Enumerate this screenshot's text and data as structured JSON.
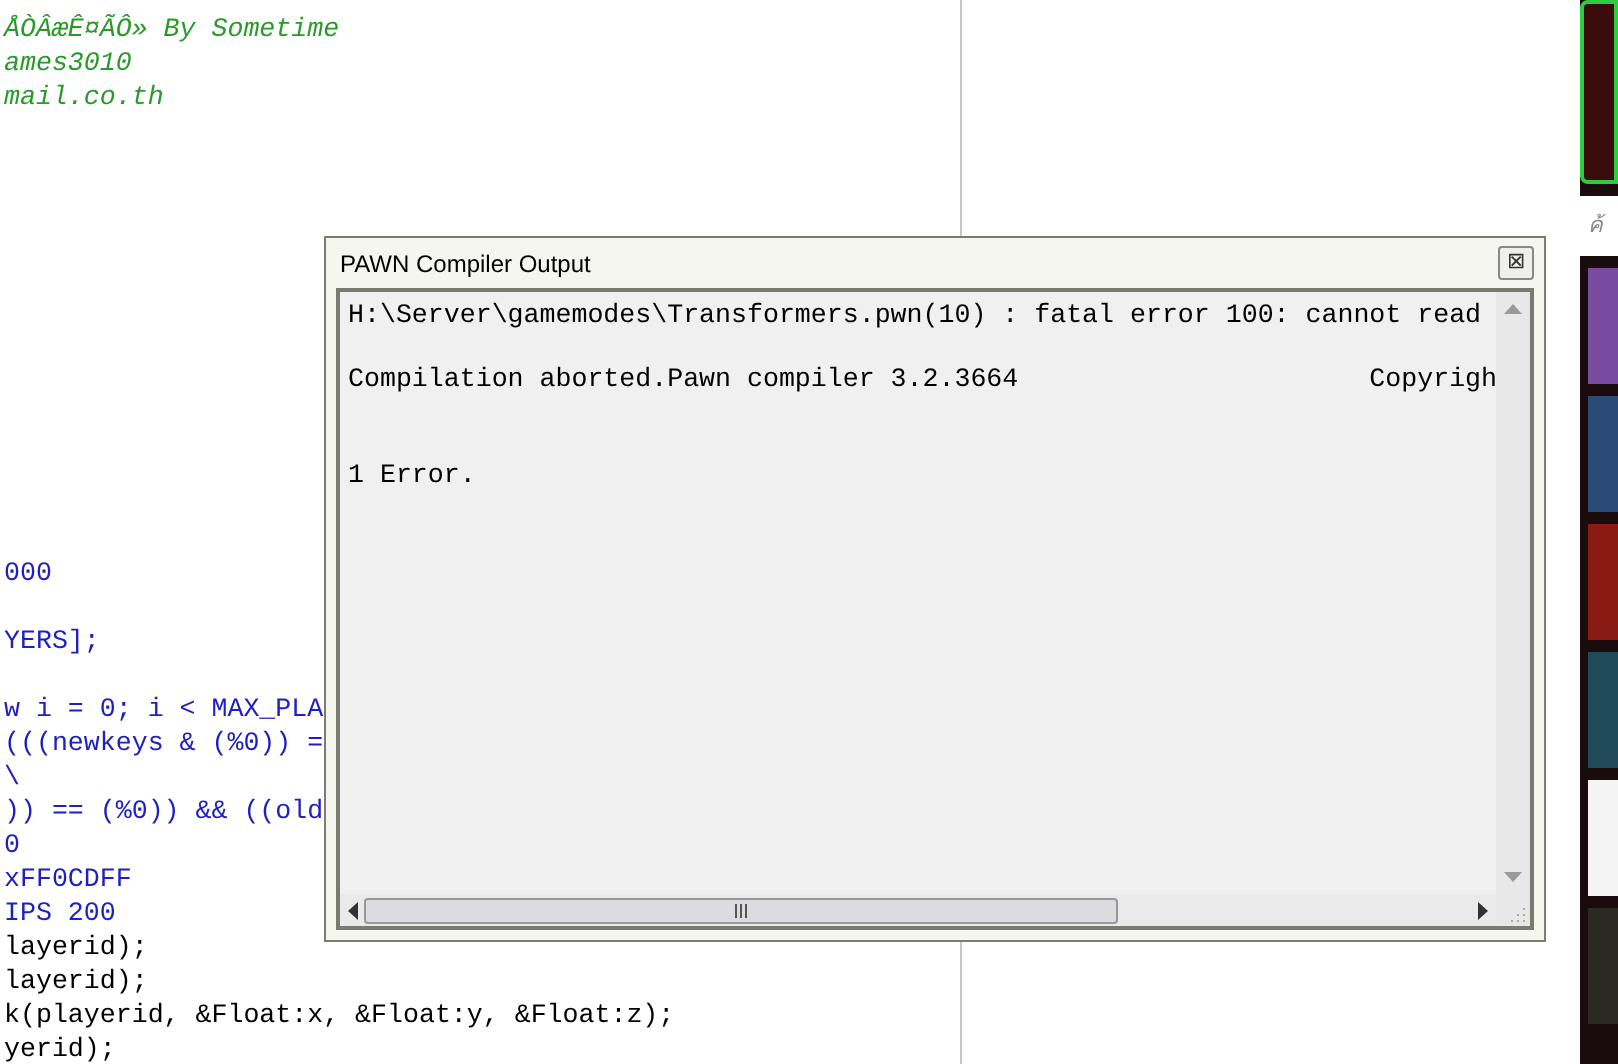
{
  "editor": {
    "lines": [
      {
        "text": "ÅÒÂæÊ¤ÃÔ» By Sometime",
        "kind": "comment"
      },
      {
        "text": "ames3010",
        "kind": "comment"
      },
      {
        "text": "mail.co.th",
        "kind": "comment"
      },
      {
        "text": "000",
        "kind": "keyword"
      },
      {
        "text": "YERS];",
        "kind": "keyword"
      },
      {
        "text": "w i = 0; i < MAX_PLA",
        "kind": "keyword"
      },
      {
        "text": "(((newkeys & (%0)) =",
        "kind": "keyword"
      },
      {
        "text": "\\",
        "kind": "keyword"
      },
      {
        "text": ")) == (%0)) && ((old",
        "kind": "keyword"
      },
      {
        "text": "0",
        "kind": "keyword"
      },
      {
        "text": "xFF0CDFF",
        "kind": "keyword"
      },
      {
        "text": "IPS 200",
        "kind": "keyword"
      },
      {
        "text": "layerid);",
        "kind": "plain"
      },
      {
        "text": "layerid);",
        "kind": "plain"
      },
      {
        "text": "k(playerid, &Float:x, &Float:y, &Float:z);",
        "kind": "plain"
      },
      {
        "text": "yerid);",
        "kind": "plain"
      }
    ]
  },
  "dialog": {
    "title": "PAWN Compiler Output",
    "close_icon": "⊠",
    "output_lines": [
      "H:\\Server\\gamemodes\\Transformers.pwn(10) : fatal error 100: cannot read",
      "Compilation aborted.Pawn compiler 3.2.3664                      Copyrigh",
      "1 Error."
    ]
  },
  "sidebar": {
    "search_text": "ค้"
  }
}
